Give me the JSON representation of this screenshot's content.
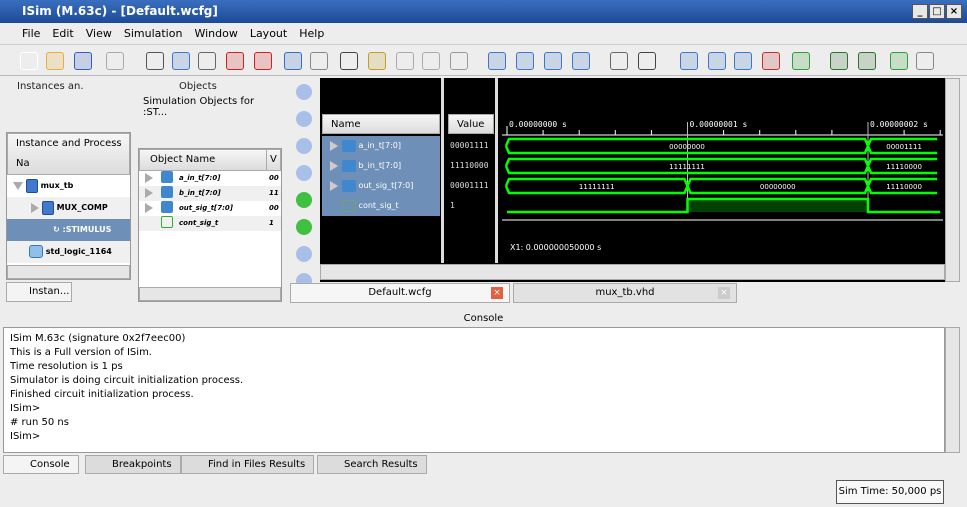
{
  "window": {
    "title": "ISim (M.63c) - [Default.wcfg]"
  },
  "menu": [
    "File",
    "Edit",
    "View",
    "Simulation",
    "Window",
    "Layout",
    "Help"
  ],
  "instances": {
    "title": "Instances an.",
    "column": "Instance and Process Na",
    "items": [
      {
        "label": "mux_tb",
        "icon": "chip-icon"
      },
      {
        "label": "MUX_COMP",
        "icon": "chip-icon"
      },
      {
        "label": ":STIMULUS",
        "icon": "process-icon"
      },
      {
        "label": "std_logic_1164",
        "icon": "package-icon"
      }
    ],
    "tab": "Instan..."
  },
  "objects": {
    "title": "Objects",
    "subtitle": "Simulation Objects for :ST...",
    "col_name": "Object Name",
    "col_value": "V",
    "items": [
      {
        "name": "a_in_t[7:0]",
        "value": "00"
      },
      {
        "name": "b_in_t[7:0]",
        "value": "11"
      },
      {
        "name": "out_sig_t[7:0]",
        "value": "00"
      },
      {
        "name": "cont_sig_t",
        "value": "1"
      }
    ]
  },
  "wave": {
    "col_name": "Name",
    "col_value": "Value",
    "signals": [
      {
        "name": "a_in_t[7:0]",
        "value": "00001111"
      },
      {
        "name": "b_in_t[7:0]",
        "value": "11110000"
      },
      {
        "name": "out_sig_t[7:0]",
        "value": "00001111"
      },
      {
        "name": "cont_sig_t",
        "value": "1"
      }
    ],
    "time_labels": [
      "0.00000000 s",
      "0.00000001 s",
      "0.00000002 s"
    ],
    "cursor": "X1: 0.000000050000 s",
    "signal_color": "#00ff00",
    "segments": [
      [
        {
          "t0": 0,
          "t1": 20,
          "v": "00000000"
        },
        {
          "t0": 20,
          "t1": 24,
          "v": "00001111"
        }
      ],
      [
        {
          "t0": 0,
          "t1": 20,
          "v": "11111111"
        },
        {
          "t0": 20,
          "t1": 24,
          "v": "11110000"
        }
      ],
      [
        {
          "t0": 0,
          "t1": 10,
          "v": "11111111"
        },
        {
          "t0": 10,
          "t1": 20,
          "v": "00000000"
        },
        {
          "t0": 20,
          "t1": 24,
          "v": "11110000"
        }
      ]
    ],
    "bit": [
      {
        "t0": 0,
        "t1": 10,
        "v": 0
      },
      {
        "t0": 10,
        "t1": 20,
        "v": 1
      },
      {
        "t0": 20,
        "t1": 24,
        "v": 0
      }
    ]
  },
  "doc_tabs": [
    "Default.wcfg",
    "mux_tb.vhd"
  ],
  "console": {
    "title": "Console",
    "lines": [
      "ISim M.63c (signature 0x2f7eec00)",
      "This is a Full version of ISim.",
      "Time resolution is 1 ps",
      "Simulator is doing circuit initialization process.",
      "Finished circuit initialization process.",
      "ISim>",
      "# run 50 ns",
      "ISim>"
    ]
  },
  "bottom_tabs": [
    "Console",
    "Breakpoints",
    "Find in Files Results",
    "Search Results"
  ],
  "status": {
    "sim_time": "Sim Time: 50,000 ps"
  }
}
